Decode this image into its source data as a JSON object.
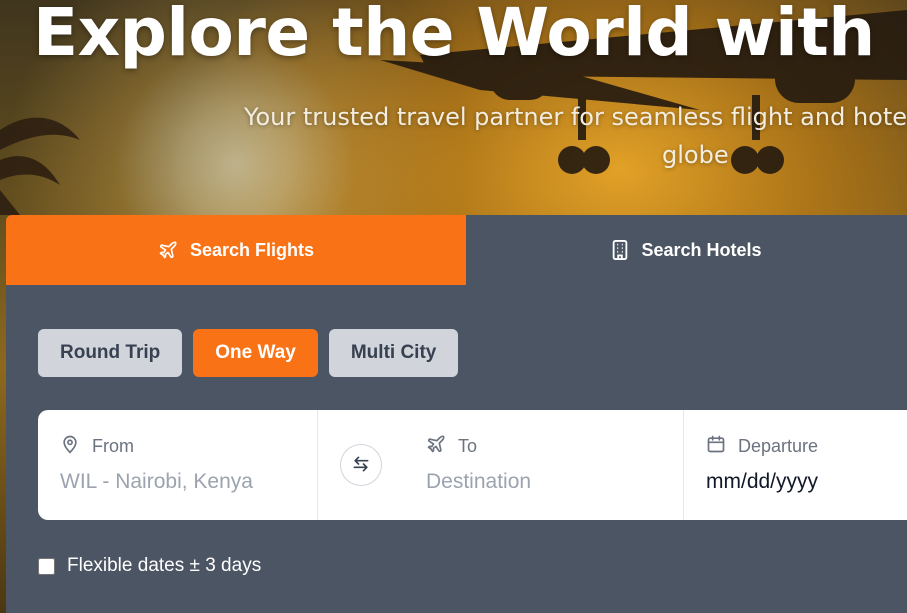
{
  "hero": {
    "title": "Explore the World with",
    "subtitle_line1": "Your trusted travel partner for seamless flight and hotel",
    "subtitle_line2": "globe"
  },
  "tabs": {
    "flights_label": "Search Flights",
    "flights_icon": "airplane-icon",
    "hotels_label": "Search Hotels",
    "hotels_icon": "building-icon",
    "active": "flights"
  },
  "trip_types": {
    "round_trip": "Round Trip",
    "one_way": "One Way",
    "multi_city": "Multi City",
    "selected": "One Way"
  },
  "fields": {
    "from": {
      "label": "From",
      "icon": "map-pin-icon",
      "placeholder": "WIL - Nairobi, Kenya"
    },
    "swap_icon": "swap-arrows-icon",
    "to": {
      "label": "To",
      "icon": "airplane-icon",
      "placeholder": "Destination"
    },
    "departure": {
      "label": "Departure",
      "icon": "calendar-icon",
      "value": "mm/dd/yyyy"
    }
  },
  "flexible_dates": {
    "label": "Flexible dates ± 3 days",
    "checked": false
  },
  "colors": {
    "accent": "#f97316",
    "panel": "#4b5563",
    "button_inactive": "#d1d5db"
  }
}
